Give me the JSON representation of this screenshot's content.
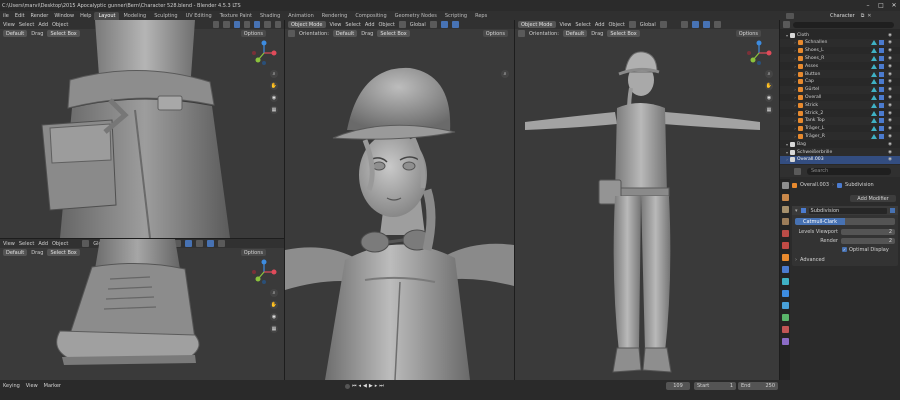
{
  "window": {
    "title": "C:\\Users\\marvi\\Desktop\\2015 Apocalyptic gunner\\Bern\\Character 528.blend - Blender 4.5.3 LTS",
    "top_right_field": "Character"
  },
  "menus": [
    "ile",
    "Edit",
    "Render",
    "Window",
    "Help"
  ],
  "workspaces": [
    "Layout",
    "Modeling",
    "Sculpting",
    "UV Editing",
    "Texture Paint",
    "Shading",
    "Animation",
    "Rendering",
    "Compositing",
    "Geometry Nodes",
    "Scripting",
    "Reps"
  ],
  "active_workspace": "Layout",
  "viewports": {
    "top_left": {
      "view": "View",
      "select": "Select",
      "add": "Add",
      "object": "Object",
      "orientation": "Default",
      "drag": "Drag",
      "select_box": "Select Box",
      "options": "Options"
    },
    "bottom_left": {
      "view": "View",
      "select": "Select",
      "add": "Add",
      "object": "Object",
      "transform": "Global",
      "orientation": "Default",
      "drag": "Drag",
      "select_box": "Select Box",
      "options": "Options"
    },
    "middle": {
      "mode": "Object Mode",
      "view": "View",
      "select": "Select",
      "add": "Add",
      "object": "Object",
      "transform": "Global",
      "orientation_label": "Orientation:",
      "orientation": "Default",
      "drag": "Drag",
      "select_box": "Select Box",
      "options": "Options"
    },
    "right": {
      "mode": "Object Mode",
      "view": "View",
      "select": "Select",
      "add": "Add",
      "object": "Object",
      "transform": "Global",
      "orientation_label": "Orientation:",
      "orientation": "Default",
      "drag": "Drag",
      "select_box": "Select Box",
      "options": "Options"
    }
  },
  "outliner": {
    "rows": [
      {
        "name": "Cloth",
        "indent": 0,
        "color": "#e0e0e0"
      },
      {
        "name": "Schnallen",
        "indent": 1,
        "color": "#e88a2e"
      },
      {
        "name": "Shoes_L",
        "indent": 1,
        "color": "#e88a2e"
      },
      {
        "name": "Shoes_R",
        "indent": 1,
        "color": "#e88a2e"
      },
      {
        "name": "Asses",
        "indent": 1,
        "color": "#e88a2e"
      },
      {
        "name": "Button",
        "indent": 1,
        "color": "#e88a2e"
      },
      {
        "name": "Cap",
        "indent": 1,
        "color": "#e88a2e"
      },
      {
        "name": "Gürtel",
        "indent": 1,
        "color": "#e88a2e"
      },
      {
        "name": "Overall",
        "indent": 1,
        "color": "#e88a2e"
      },
      {
        "name": "Strick",
        "indent": 1,
        "color": "#e88a2e"
      },
      {
        "name": "Strick_2",
        "indent": 1,
        "color": "#e88a2e"
      },
      {
        "name": "Tank Top",
        "indent": 1,
        "color": "#e88a2e"
      },
      {
        "name": "Träger_L",
        "indent": 1,
        "color": "#e88a2e"
      },
      {
        "name": "Träger_R",
        "indent": 1,
        "color": "#e88a2e"
      },
      {
        "name": "Bag",
        "indent": 0,
        "color": "#e0e0e0"
      },
      {
        "name": "Schweißerbrille",
        "indent": 0,
        "color": "#e0e0e0"
      },
      {
        "name": "Overall.003",
        "indent": 0,
        "color": "#ffffff",
        "selected": true
      }
    ]
  },
  "properties": {
    "search_placeholder": "Search",
    "object_name": "Overall.003",
    "modifier_tab": "Subdivision",
    "add_modifier": "Add Modifier",
    "modifier_name": "Subdivision",
    "mode_button": "Catmull-Clark",
    "levels_viewport_label": "Levels Viewport",
    "levels_viewport_value": "2",
    "render_label": "Render",
    "render_value": "2",
    "optimal_display": "Optimal Display",
    "advanced": "Advanced"
  },
  "timeline": {
    "keying": "Keying",
    "view": "View",
    "marker": "Marker",
    "current_frame": "109",
    "start_label": "Start",
    "start_value": "1",
    "end_label": "End",
    "end_value": "250"
  },
  "colors": {
    "accent_blue": "#4772b3",
    "object_orange": "#e88a2e",
    "modifier_teal": "#3fb1c4",
    "viewport_bg": "#3a3a3a",
    "axis_x": "#e04b5a",
    "axis_y": "#8bc23c",
    "axis_z": "#3d8ce0"
  }
}
